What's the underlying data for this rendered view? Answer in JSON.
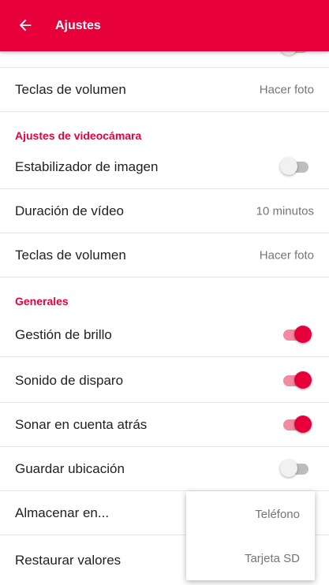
{
  "appbar": {
    "title": "Ajustes",
    "background_color": "#e8003b",
    "back_icon": "arrow-left-icon"
  },
  "sections": {
    "photo": {
      "items": [
        {
          "label": "Teclas de volumen",
          "value": "Hacer foto"
        }
      ]
    },
    "video": {
      "header": "Ajustes de videocámara",
      "items": [
        {
          "label": "Estabilizador de imagen",
          "toggle": false
        },
        {
          "label": "Duración de vídeo",
          "value": "10 minutos"
        },
        {
          "label": "Teclas de volumen",
          "value": "Hacer foto"
        }
      ]
    },
    "general": {
      "header": "Generales",
      "items": [
        {
          "label": "Gestión de brillo",
          "toggle": true
        },
        {
          "label": "Sonido de disparo",
          "toggle": true
        },
        {
          "label": "Sonar en cuenta atrás",
          "toggle": true
        },
        {
          "label": "Guardar ubicación",
          "toggle": false
        },
        {
          "label": "Almacenar en..."
        },
        {
          "label": "Restaurar valores"
        }
      ]
    }
  },
  "storage_menu": {
    "options": [
      "Teléfono",
      "Tarjeta SD"
    ]
  },
  "colors": {
    "accent": "#e8003b",
    "toggle_on_track": "#f48a9f",
    "toggle_off_track": "#bdbdbd"
  }
}
